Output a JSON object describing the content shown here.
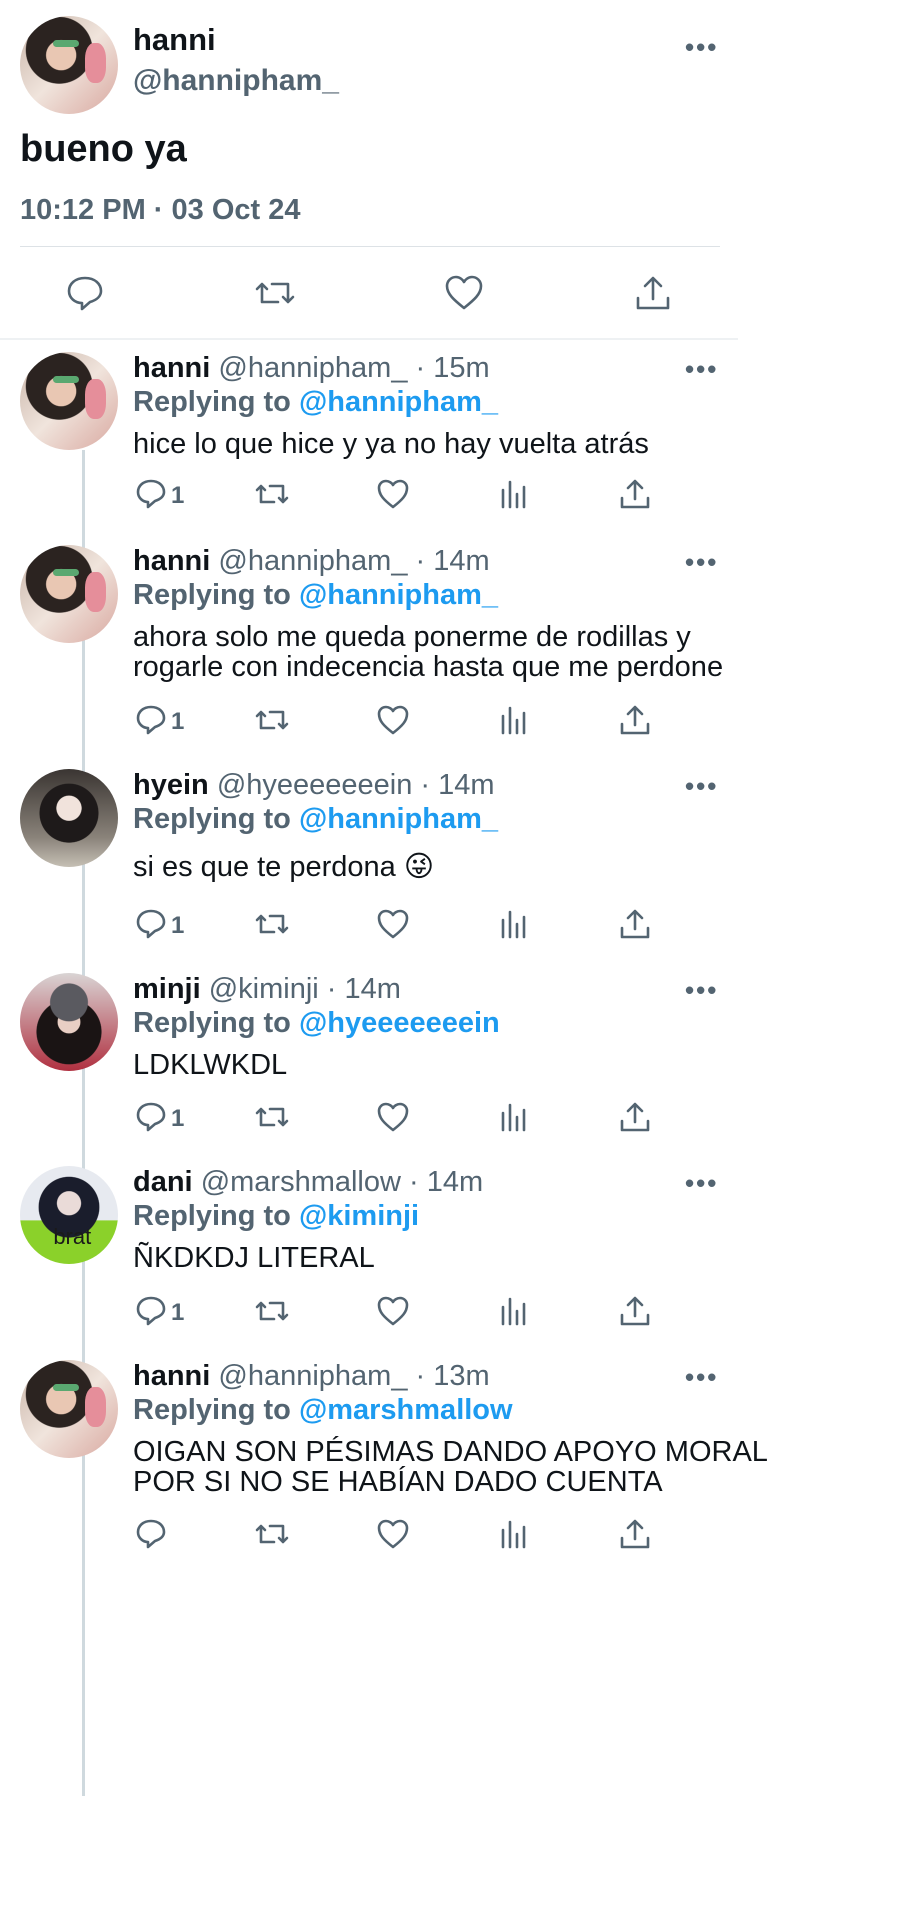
{
  "main_tweet": {
    "name": "hanni",
    "handle": "@hannipham_",
    "text": "bueno ya",
    "timestamp": "10:12 PM · 03 Oct 24",
    "more": "•••"
  },
  "replies": [
    {
      "name": "hanni",
      "handle": "@hannipham_",
      "time": "· 15m",
      "replying_label": "Replying to",
      "replying_to": "@hannipham_",
      "text": [
        "hice lo que hice y ya no hay vuelta atrás"
      ],
      "reply_count": "1",
      "avatar": "hanni"
    },
    {
      "name": "hanni",
      "handle": "@hannipham_",
      "time": "· 14m",
      "replying_label": "Replying to",
      "replying_to": "@hannipham_",
      "text": [
        "ahora solo me queda ponerme de rodillas y",
        "rogarle con indecencia hasta que me perdone"
      ],
      "reply_count": "1",
      "avatar": "hanni"
    },
    {
      "name": "hyein",
      "handle": "@hyeeeeeeein",
      "time": "· 14m",
      "replying_label": "Replying to",
      "replying_to": "@hannipham_",
      "text": [
        "si es que te perdona 😜"
      ],
      "reply_count": "1",
      "avatar": "hyein"
    },
    {
      "name": "minji",
      "handle": "@kiminji",
      "time": "· 14m",
      "replying_label": "Replying to",
      "replying_to": "@hyeeeeeeein",
      "text": [
        "LDKLWKDL"
      ],
      "reply_count": "1",
      "avatar": "minji"
    },
    {
      "name": "dani",
      "handle": "@marshmallow",
      "time": "· 14m",
      "replying_label": "Replying to",
      "replying_to": "@kiminji",
      "text": [
        "ÑKDKDJ LITERAL"
      ],
      "reply_count": "1",
      "avatar": "dani",
      "avatar_text": "brat"
    },
    {
      "name": "hanni",
      "handle": "@hannipham_",
      "time": "· 13m",
      "replying_label": "Replying to",
      "replying_to": "@marshmallow",
      "text": [
        "OIGAN SON PÉSIMAS DANDO APOYO MORAL",
        "POR SI NO SE HABÍAN DADO CUENTA"
      ],
      "reply_count": "",
      "avatar": "hanni"
    }
  ],
  "colors": {
    "accent": "#1d9bf0",
    "secondary_text": "#536471"
  }
}
